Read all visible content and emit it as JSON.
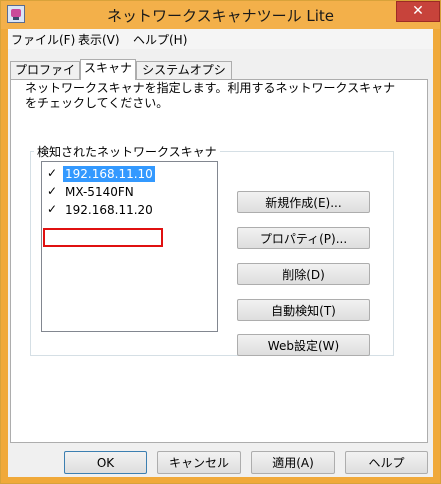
{
  "window": {
    "title": "ネットワークスキャナツール Lite",
    "close_glyph": "✕"
  },
  "menu": [
    "ファイル(F)",
    "表示(V)",
    "ヘルプ(H)"
  ],
  "tabs": [
    {
      "label": "プロファイル",
      "active": false
    },
    {
      "label": "スキャナ",
      "active": true
    },
    {
      "label": "システムオプション",
      "active": false
    }
  ],
  "panel": {
    "description": "ネットワークスキャナを指定します。利用するネットワークスキャナをチェックしてください。",
    "group_label": "検知されたネットワークスキャナ",
    "scanners": [
      {
        "name": "192.168.11.10",
        "checked": true,
        "selected": true
      },
      {
        "name": "MX-5140FN",
        "checked": true,
        "selected": false
      },
      {
        "name": "192.168.11.20",
        "checked": true,
        "selected": false,
        "highlighted": true
      }
    ],
    "check_glyph": "✓",
    "buttons": {
      "new": "新規作成(E)...",
      "properties": "プロパティ(P)...",
      "delete": "削除(D)",
      "auto_detect": "自動検知(T)",
      "web_settings": "Web設定(W)"
    }
  },
  "footer": {
    "ok": "OK",
    "cancel": "キャンセル",
    "apply": "適用(A)",
    "help": "ヘルプ"
  },
  "colors": {
    "title_bar": "#f3b04a",
    "close_button": "#c7433b",
    "selection": "#3399ff",
    "highlight_box": "#e01010"
  }
}
